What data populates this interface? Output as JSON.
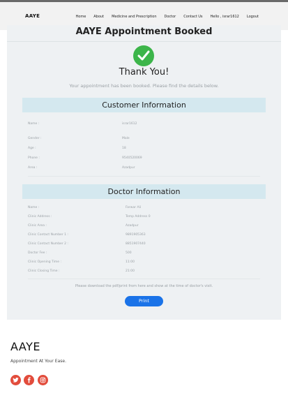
{
  "nav": {
    "brand": "AAYE",
    "items": [
      "Home",
      "About",
      "Medicine and Prescription",
      "Doctor",
      "Contact Us",
      "Hello , israr1612",
      "Logout"
    ]
  },
  "main": {
    "title": "AAYE Appointment Booked",
    "thanks": "Thank You!",
    "subtitle": "Your appointment has been booked. Please find the details below."
  },
  "customer": {
    "heading": "Customer Information",
    "rows": [
      {
        "label": "Name :",
        "value": "israr1612"
      },
      {
        "label": "Gender :",
        "value": "Male"
      },
      {
        "label": "Age :",
        "value": "18"
      },
      {
        "label": "Phone :",
        "value": "9540520069"
      },
      {
        "label": "Area :",
        "value": "Azadpur"
      }
    ]
  },
  "doctor": {
    "heading": "Doctor Information",
    "rows": [
      {
        "label": "Name :",
        "value": "Farwar Ali"
      },
      {
        "label": "Clinic Address :",
        "value": "Temp Address 0"
      },
      {
        "label": "Clinic Area :",
        "value": "Azadpur"
      },
      {
        "label": "Clinic Contact Number 1 :",
        "value": "9891905363"
      },
      {
        "label": "Clinic Contact Number 2 :",
        "value": "8851907440"
      },
      {
        "label": "Doctor Fee :",
        "value": "500"
      },
      {
        "label": "Clinic Opening Time :",
        "value": "11:00"
      },
      {
        "label": "Clinic Closing Time :",
        "value": "21:00"
      }
    ]
  },
  "note": "Please download the pdf/print from here and show at the time of doctor's visit.",
  "print_label": "Print",
  "footer": {
    "brand": "AAYE",
    "tagline": "Appointment At Your Ease.",
    "social": [
      "twitter-icon",
      "facebook-icon",
      "instagram-icon"
    ]
  },
  "colors": {
    "accent": "#1a73e8",
    "success": "#3cb54a",
    "section": "#d4e8ef",
    "social": "#e24c3c"
  }
}
